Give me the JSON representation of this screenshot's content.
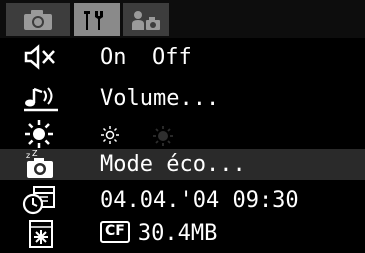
{
  "tabs": [
    {
      "name": "camera-tab",
      "selected": false
    },
    {
      "name": "settings-tab",
      "selected": true
    },
    {
      "name": "mycamera-tab",
      "selected": false
    }
  ],
  "rows": {
    "mute": {
      "icon": "speaker-muted-icon",
      "option_on": "On",
      "option_off": "Off",
      "selected": "Off"
    },
    "volume": {
      "icon": "volume-icon",
      "label": "Volume..."
    },
    "lcd": {
      "icon": "brightness-icon",
      "options": [
        "bright",
        "dark"
      ],
      "selected": "bright"
    },
    "eco": {
      "icon": "power-saving-icon",
      "label": "Mode éco..."
    },
    "date": {
      "icon": "date-time-icon",
      "value": "04.04.'04 09:30"
    },
    "format": {
      "icon": "format-card-icon",
      "card_label": "CF",
      "size": "30.4MB"
    }
  },
  "colors": {
    "background": "#000000",
    "selected_tab": "#8a8a8a",
    "tab": "#3d3d3d",
    "highlight_row": "#2a2a2a",
    "inactive_text": "#2e2e2e"
  }
}
